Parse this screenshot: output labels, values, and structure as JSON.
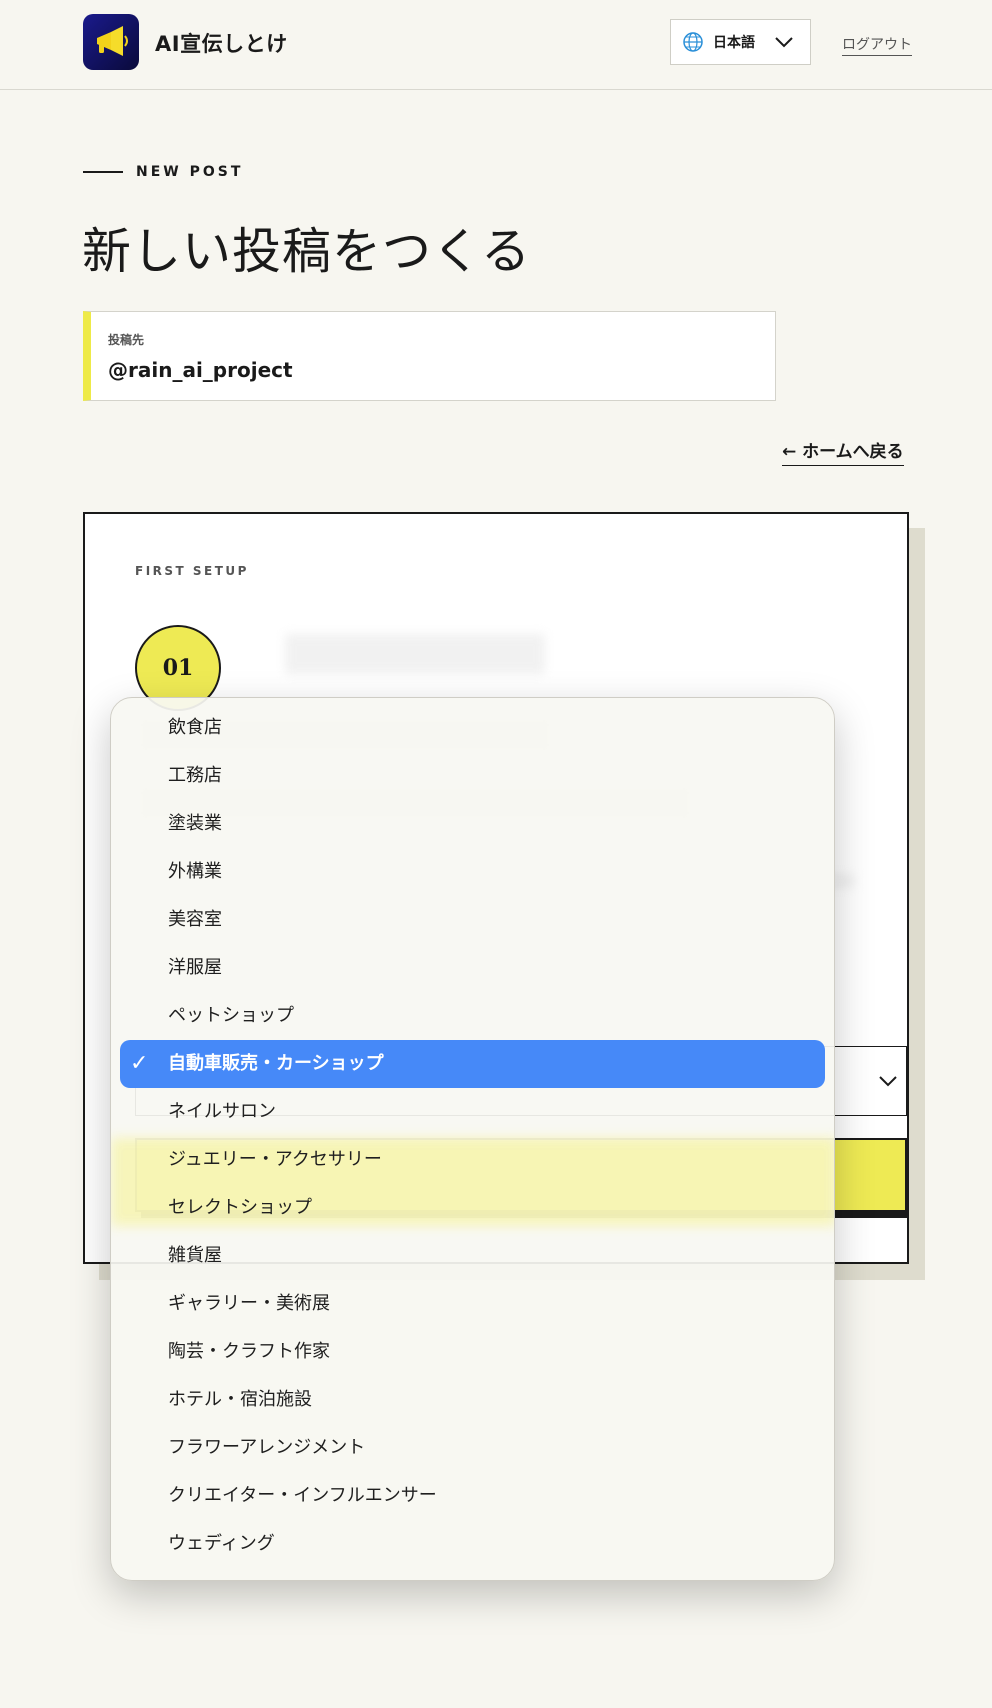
{
  "header": {
    "app_name": "AI宣伝しとけ",
    "language": "日本語",
    "logout": "ログアウト"
  },
  "page": {
    "eyebrow": "NEW POST",
    "title": "新しい投稿をつくる",
    "target_label": "投稿先",
    "target_value": "@rain_ai_project",
    "back_link": "← ホームへ戻る"
  },
  "card": {
    "eyebrow": "FIRST SETUP",
    "step_number": "01"
  },
  "dropdown": {
    "selected": "自動車販売・カーショップ",
    "check": "✓",
    "options": [
      "飲食店",
      "工務店",
      "塗装業",
      "外構業",
      "美容室",
      "洋服屋",
      "ペットショップ",
      "自動車販売・カーショップ",
      "ネイルサロン",
      "ジュエリー・アクセサリー",
      "セレクトショップ",
      "雑貨屋",
      "ギャラリー・美術展",
      "陶芸・クラフト作家",
      "ホテル・宿泊施設",
      "フラワーアレンジメント",
      "クリエイター・インフルエンサー",
      "ウェディング"
    ]
  },
  "colors": {
    "background": "#f7f6f0",
    "accent_yellow": "#eeea54",
    "selected_blue": "#4689f8",
    "logo_navy": "#1a1a8c"
  },
  "icons": {
    "logo": "megaphone-icon",
    "language": "globe-icon",
    "chevron": "chevron-down-icon",
    "check": "checkmark-icon"
  }
}
